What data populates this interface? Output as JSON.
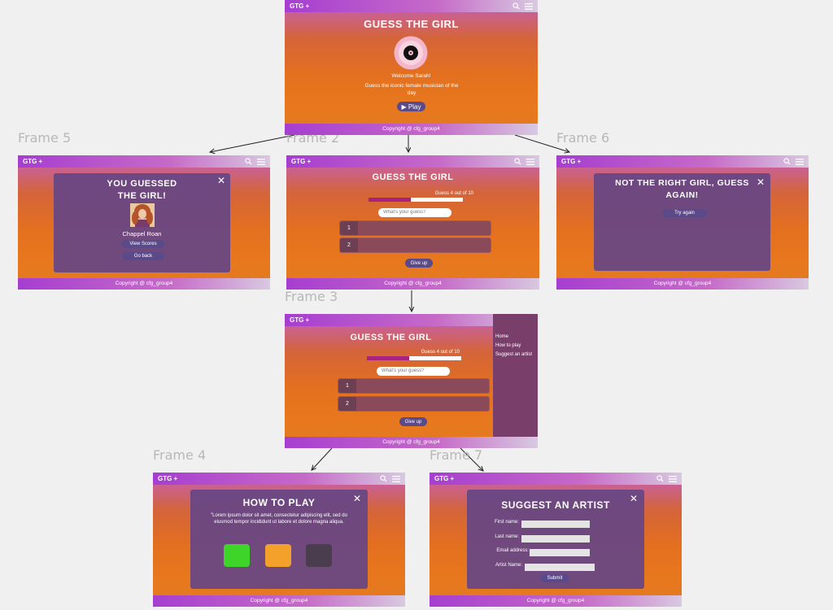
{
  "frames": {
    "f2": "Frame 2",
    "f3": "Frame 3",
    "f4": "Frame 4",
    "f5": "Frame 5",
    "f6": "Frame 6",
    "f7": "Frame 7"
  },
  "app": {
    "logo": "GTG +",
    "title": "GUESS THE GIRL",
    "copyright": "Copyright @ cfg_group4"
  },
  "home": {
    "welcome": "Welcome Sarah!",
    "tagline": "Guess the iconic female musician of the day",
    "play": "▶ Play"
  },
  "game": {
    "guess_count": "Guess 4 out of 10",
    "progress_fraction": 0.45,
    "placeholder": "What's your guess?",
    "row1": "1",
    "row2": "2",
    "give_up": "Give up"
  },
  "menu": {
    "home": "Home",
    "how": "How to play",
    "suggest": "Suggest an artist"
  },
  "correct": {
    "heading_1": "YOU GUESSED",
    "heading_2": "THE GIRL!",
    "artist": "Chappel Roan",
    "view_scores": "View Scores",
    "go_back": "Go back"
  },
  "wrong": {
    "heading_1": "NOT THE RIGHT GIRL, GUESS",
    "heading_2": "AGAIN!",
    "try_again": "Try again"
  },
  "howto": {
    "heading": "HOW TO PLAY",
    "body": "\"Lorem ipsum dolor sit amet, consectetur adipiscing elit, sed do eiusmod tempor incididunt ut labore et dolore magna aliqua.",
    "colors": [
      "#3fd42a",
      "#f3a12a",
      "#4a3e4e"
    ]
  },
  "suggest": {
    "heading": "SUGGEST AN ARTIST",
    "first": "First name:",
    "last": "Last name:",
    "email": "Email address:",
    "artist": "Artist Name:",
    "submit": "Submit"
  }
}
